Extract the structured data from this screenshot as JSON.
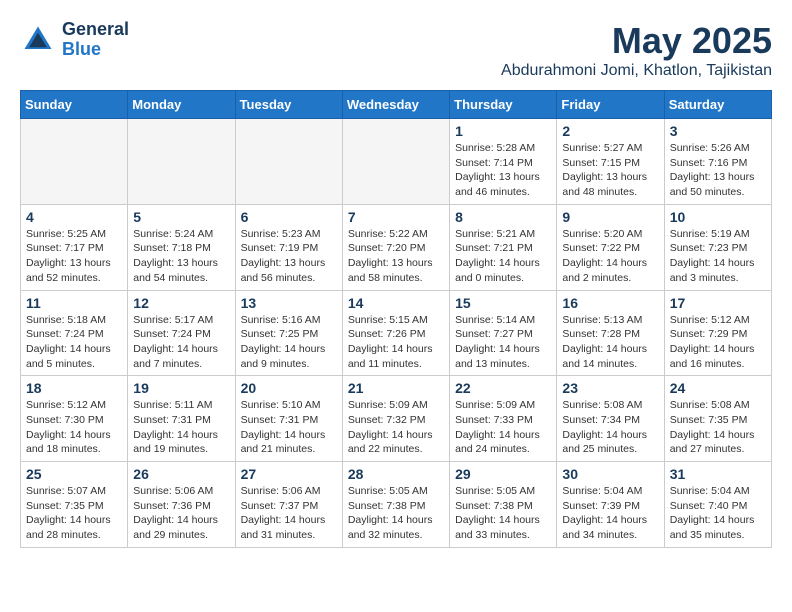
{
  "logo": {
    "line1": "General",
    "line2": "Blue"
  },
  "title": "May 2025",
  "location": "Abdurahmoni Jomi, Khatlon, Tajikistan",
  "weekdays": [
    "Sunday",
    "Monday",
    "Tuesday",
    "Wednesday",
    "Thursday",
    "Friday",
    "Saturday"
  ],
  "weeks": [
    [
      {
        "day": "",
        "info": ""
      },
      {
        "day": "",
        "info": ""
      },
      {
        "day": "",
        "info": ""
      },
      {
        "day": "",
        "info": ""
      },
      {
        "day": "1",
        "info": "Sunrise: 5:28 AM\nSunset: 7:14 PM\nDaylight: 13 hours\nand 46 minutes."
      },
      {
        "day": "2",
        "info": "Sunrise: 5:27 AM\nSunset: 7:15 PM\nDaylight: 13 hours\nand 48 minutes."
      },
      {
        "day": "3",
        "info": "Sunrise: 5:26 AM\nSunset: 7:16 PM\nDaylight: 13 hours\nand 50 minutes."
      }
    ],
    [
      {
        "day": "4",
        "info": "Sunrise: 5:25 AM\nSunset: 7:17 PM\nDaylight: 13 hours\nand 52 minutes."
      },
      {
        "day": "5",
        "info": "Sunrise: 5:24 AM\nSunset: 7:18 PM\nDaylight: 13 hours\nand 54 minutes."
      },
      {
        "day": "6",
        "info": "Sunrise: 5:23 AM\nSunset: 7:19 PM\nDaylight: 13 hours\nand 56 minutes."
      },
      {
        "day": "7",
        "info": "Sunrise: 5:22 AM\nSunset: 7:20 PM\nDaylight: 13 hours\nand 58 minutes."
      },
      {
        "day": "8",
        "info": "Sunrise: 5:21 AM\nSunset: 7:21 PM\nDaylight: 14 hours\nand 0 minutes."
      },
      {
        "day": "9",
        "info": "Sunrise: 5:20 AM\nSunset: 7:22 PM\nDaylight: 14 hours\nand 2 minutes."
      },
      {
        "day": "10",
        "info": "Sunrise: 5:19 AM\nSunset: 7:23 PM\nDaylight: 14 hours\nand 3 minutes."
      }
    ],
    [
      {
        "day": "11",
        "info": "Sunrise: 5:18 AM\nSunset: 7:24 PM\nDaylight: 14 hours\nand 5 minutes."
      },
      {
        "day": "12",
        "info": "Sunrise: 5:17 AM\nSunset: 7:24 PM\nDaylight: 14 hours\nand 7 minutes."
      },
      {
        "day": "13",
        "info": "Sunrise: 5:16 AM\nSunset: 7:25 PM\nDaylight: 14 hours\nand 9 minutes."
      },
      {
        "day": "14",
        "info": "Sunrise: 5:15 AM\nSunset: 7:26 PM\nDaylight: 14 hours\nand 11 minutes."
      },
      {
        "day": "15",
        "info": "Sunrise: 5:14 AM\nSunset: 7:27 PM\nDaylight: 14 hours\nand 13 minutes."
      },
      {
        "day": "16",
        "info": "Sunrise: 5:13 AM\nSunset: 7:28 PM\nDaylight: 14 hours\nand 14 minutes."
      },
      {
        "day": "17",
        "info": "Sunrise: 5:12 AM\nSunset: 7:29 PM\nDaylight: 14 hours\nand 16 minutes."
      }
    ],
    [
      {
        "day": "18",
        "info": "Sunrise: 5:12 AM\nSunset: 7:30 PM\nDaylight: 14 hours\nand 18 minutes."
      },
      {
        "day": "19",
        "info": "Sunrise: 5:11 AM\nSunset: 7:31 PM\nDaylight: 14 hours\nand 19 minutes."
      },
      {
        "day": "20",
        "info": "Sunrise: 5:10 AM\nSunset: 7:31 PM\nDaylight: 14 hours\nand 21 minutes."
      },
      {
        "day": "21",
        "info": "Sunrise: 5:09 AM\nSunset: 7:32 PM\nDaylight: 14 hours\nand 22 minutes."
      },
      {
        "day": "22",
        "info": "Sunrise: 5:09 AM\nSunset: 7:33 PM\nDaylight: 14 hours\nand 24 minutes."
      },
      {
        "day": "23",
        "info": "Sunrise: 5:08 AM\nSunset: 7:34 PM\nDaylight: 14 hours\nand 25 minutes."
      },
      {
        "day": "24",
        "info": "Sunrise: 5:08 AM\nSunset: 7:35 PM\nDaylight: 14 hours\nand 27 minutes."
      }
    ],
    [
      {
        "day": "25",
        "info": "Sunrise: 5:07 AM\nSunset: 7:35 PM\nDaylight: 14 hours\nand 28 minutes."
      },
      {
        "day": "26",
        "info": "Sunrise: 5:06 AM\nSunset: 7:36 PM\nDaylight: 14 hours\nand 29 minutes."
      },
      {
        "day": "27",
        "info": "Sunrise: 5:06 AM\nSunset: 7:37 PM\nDaylight: 14 hours\nand 31 minutes."
      },
      {
        "day": "28",
        "info": "Sunrise: 5:05 AM\nSunset: 7:38 PM\nDaylight: 14 hours\nand 32 minutes."
      },
      {
        "day": "29",
        "info": "Sunrise: 5:05 AM\nSunset: 7:38 PM\nDaylight: 14 hours\nand 33 minutes."
      },
      {
        "day": "30",
        "info": "Sunrise: 5:04 AM\nSunset: 7:39 PM\nDaylight: 14 hours\nand 34 minutes."
      },
      {
        "day": "31",
        "info": "Sunrise: 5:04 AM\nSunset: 7:40 PM\nDaylight: 14 hours\nand 35 minutes."
      }
    ]
  ]
}
